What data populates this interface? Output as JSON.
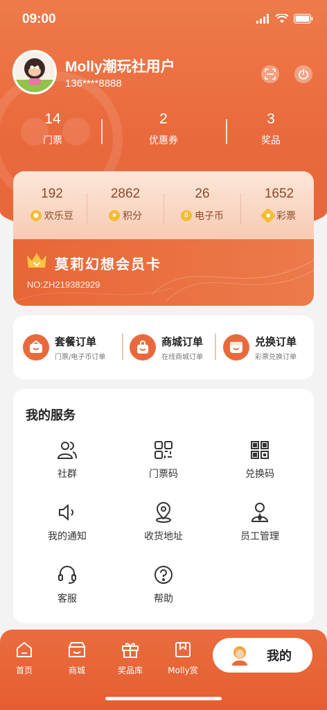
{
  "status_bar": {
    "time": "09:00"
  },
  "profile": {
    "username": "Molly潮玩社用户",
    "phone": "136****8888"
  },
  "stats": [
    {
      "value": "14",
      "label": "门票"
    },
    {
      "value": "2",
      "label": "优惠券"
    },
    {
      "value": "3",
      "label": "奖品"
    }
  ],
  "balances": [
    {
      "value": "192",
      "label": "欢乐豆",
      "icon": "joy-bean-icon"
    },
    {
      "value": "2862",
      "label": "积分",
      "icon": "points-star-icon"
    },
    {
      "value": "26",
      "label": "电子币",
      "icon": "e-coin-icon"
    },
    {
      "value": "1652",
      "label": "彩票",
      "icon": "lottery-ticket-icon"
    }
  ],
  "member_card": {
    "title": "莫莉幻想会员卡",
    "number": "NO:ZH219382929"
  },
  "orders": [
    {
      "title": "套餐订单",
      "subtitle": "门票/电子币订单"
    },
    {
      "title": "商城订单",
      "subtitle": "在线商城订单"
    },
    {
      "title": "兑换订单",
      "subtitle": "彩票兑换订单"
    }
  ],
  "services": {
    "title": "我的服务",
    "items": [
      {
        "label": "社群",
        "icon": "community-icon"
      },
      {
        "label": "门票码",
        "icon": "ticket-code-icon"
      },
      {
        "label": "兑换码",
        "icon": "redeem-qr-icon"
      },
      {
        "label": "我的通知",
        "icon": "speaker-icon"
      },
      {
        "label": "收货地址",
        "icon": "location-pin-icon"
      },
      {
        "label": "员工管理",
        "icon": "staff-icon"
      },
      {
        "label": "客服",
        "icon": "headset-icon"
      },
      {
        "label": "帮助",
        "icon": "help-icon"
      }
    ]
  },
  "bottom_nav": {
    "items": [
      {
        "label": "首页",
        "icon": "home-icon"
      },
      {
        "label": "商城",
        "icon": "shop-icon"
      },
      {
        "label": "奖品库",
        "icon": "gift-box-icon"
      },
      {
        "label": "Molly赏",
        "icon": "bookmark-book-icon"
      }
    ],
    "active": {
      "label": "我的",
      "icon": "profile-avatar-icon"
    }
  },
  "colors": {
    "primary": "#e9693c",
    "card_light": "#fde6d8",
    "text_dark": "#222222",
    "text_muted": "#777777"
  }
}
